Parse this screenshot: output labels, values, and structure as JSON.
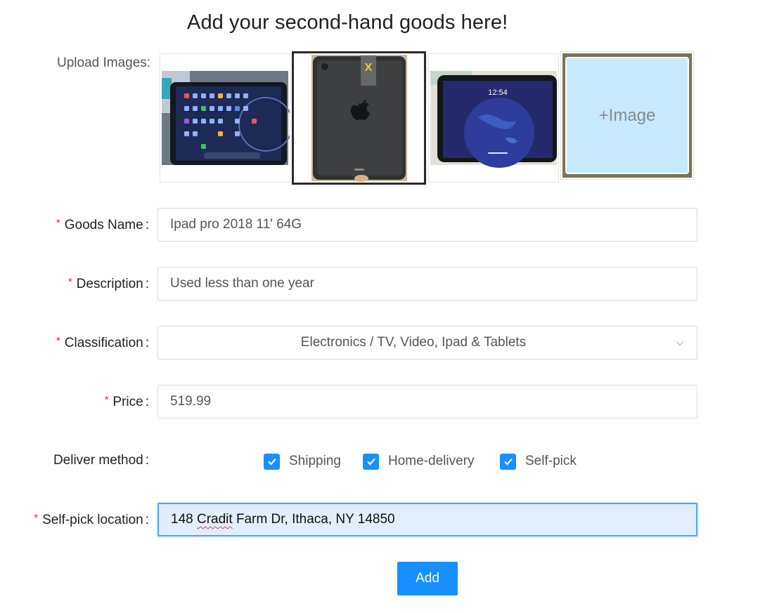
{
  "page": {
    "title": "Add your second-hand goods here!"
  },
  "upload": {
    "label": "Upload Images:",
    "delete_label": "X",
    "add_image_label": "+Image",
    "images": [
      {
        "name": "ipad-home-screen-photo"
      },
      {
        "name": "ipad-back-photo"
      },
      {
        "name": "ipad-lock-screen-photo",
        "clock": "12:54"
      }
    ]
  },
  "form": {
    "goods_name": {
      "label": "Goods Name",
      "value": "Ipad pro 2018 11' 64G",
      "required": true
    },
    "description": {
      "label": "Description",
      "value": "Used less than one year",
      "required": true
    },
    "classification": {
      "label": "Classification",
      "value": "Electronics / TV, Video, Ipad & Tablets",
      "required": true
    },
    "price": {
      "label": "Price",
      "value": "519.99",
      "required": true
    },
    "deliver_method": {
      "label": "Deliver method",
      "options": [
        {
          "label": "Shipping",
          "checked": true
        },
        {
          "label": "Home-delivery",
          "checked": true
        },
        {
          "label": "Self-pick",
          "checked": true
        }
      ]
    },
    "self_pick_location": {
      "label": "Self-pick location",
      "value_prefix": "148 ",
      "value_misspelled": "Cradit",
      "value_suffix": " Farm Dr, Ithaca, NY 14850",
      "required": true
    },
    "colon": ":",
    "required_mark": "*"
  },
  "actions": {
    "add_label": "Add"
  },
  "colors": {
    "primary": "#1890ff",
    "required": "#f5222d",
    "focus_bg": "#e2eefb",
    "add_tile": "#c7e9fc"
  }
}
